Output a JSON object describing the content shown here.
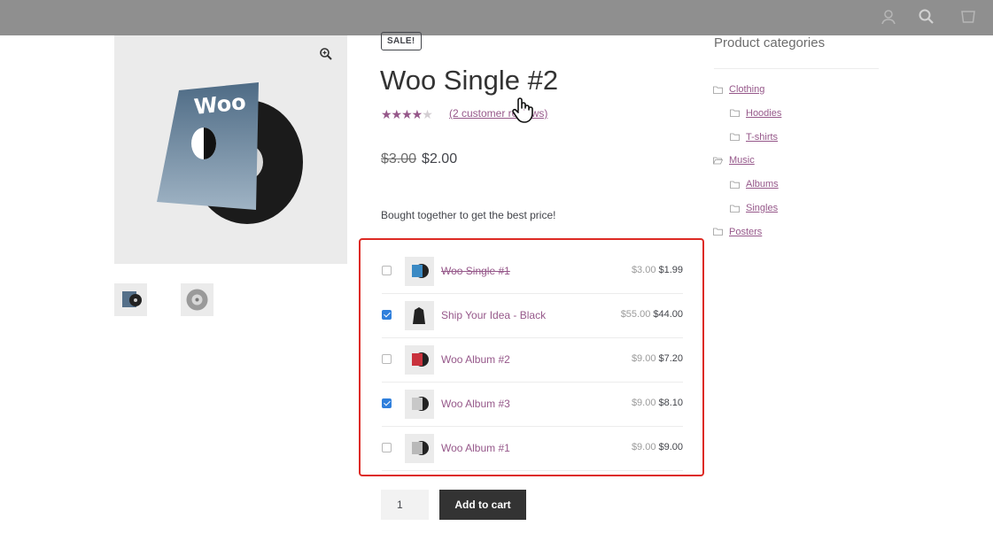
{
  "header": {
    "icons": [
      "user-icon",
      "search-icon",
      "cart-icon"
    ]
  },
  "product": {
    "sale_badge": "SALE!",
    "title": "Woo Single #2",
    "rating_stars": 4.5,
    "reviews_link": "(2 customer reviews)",
    "old_price": "$3.00",
    "price": "$2.00",
    "cover_text": "Woo"
  },
  "bought_together": {
    "intro": "Bought together to get the best price!",
    "items": [
      {
        "name": "Woo Single #1",
        "old_price": "$3.00",
        "price": "$1.99",
        "checked": false,
        "struck": true,
        "thumb_color": "#3b8ac4"
      },
      {
        "name": "Ship Your Idea - Black",
        "old_price": "$55.00",
        "price": "$44.00",
        "checked": true,
        "struck": false,
        "thumb_color": "#222222"
      },
      {
        "name": "Woo Album #2",
        "old_price": "$9.00",
        "price": "$7.20",
        "checked": false,
        "struck": false,
        "thumb_color": "#c9323d"
      },
      {
        "name": "Woo Album #3",
        "old_price": "$9.00",
        "price": "$8.10",
        "checked": true,
        "struck": false,
        "thumb_color": "#c8c8c8"
      },
      {
        "name": "Woo Album #1",
        "old_price": "$9.00",
        "price": "$9.00",
        "checked": false,
        "struck": false,
        "thumb_color": "#b9b9b9"
      }
    ]
  },
  "cart": {
    "quantity": "1",
    "add_to_cart": "Add to cart"
  },
  "sidebar": {
    "title": "Product categories",
    "categories": [
      {
        "label": "Clothing",
        "level": 0,
        "open": false
      },
      {
        "label": "Hoodies",
        "level": 1,
        "open": false
      },
      {
        "label": "T-shirts",
        "level": 1,
        "open": false
      },
      {
        "label": "Music",
        "level": 0,
        "open": true
      },
      {
        "label": "Albums",
        "level": 1,
        "open": false
      },
      {
        "label": "Singles",
        "level": 1,
        "open": false
      },
      {
        "label": "Posters",
        "level": 0,
        "open": false
      }
    ]
  },
  "colors": {
    "accent": "#96588a",
    "highlight_border": "#dd2a24",
    "button": "#333333",
    "checkbox": "#2f7fdc"
  }
}
